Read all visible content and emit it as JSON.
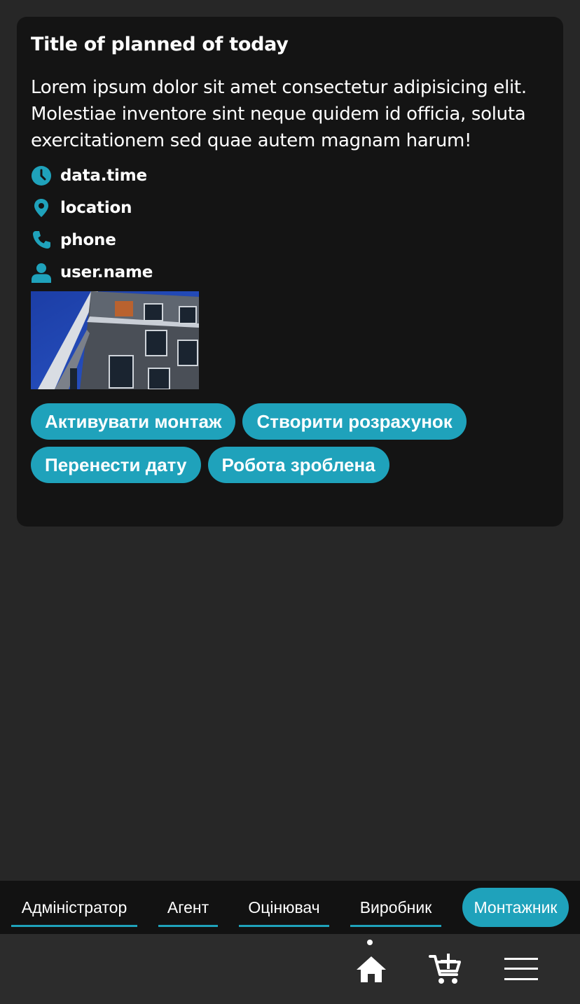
{
  "card": {
    "title": "Title of planned of today",
    "description": "Lorem ipsum dolor sit amet consectetur adipisicing elit. Molestiae inventore sint neque quidem id officia, soluta exercitationem sed quae autem magnam harum!",
    "meta": {
      "time": "data.time",
      "location": "location",
      "phone": "phone",
      "user": "user.name"
    },
    "image_icon": "building-photo",
    "actions": [
      "Активувати монтаж",
      "Створити розрахунок",
      "Перенести дату",
      "Робота зроблена"
    ]
  },
  "roles": {
    "items": [
      "Адміністратор",
      "Агент",
      "Оцінювач",
      "Виробник",
      "Монтажник"
    ],
    "active": "Монтажник"
  },
  "nav": {
    "icons": [
      "home-icon",
      "cart-add-icon",
      "menu-icon"
    ],
    "active": "home-icon"
  },
  "colors": {
    "accent": "#1fa2bb",
    "background": "#272727",
    "card": "#141414"
  }
}
